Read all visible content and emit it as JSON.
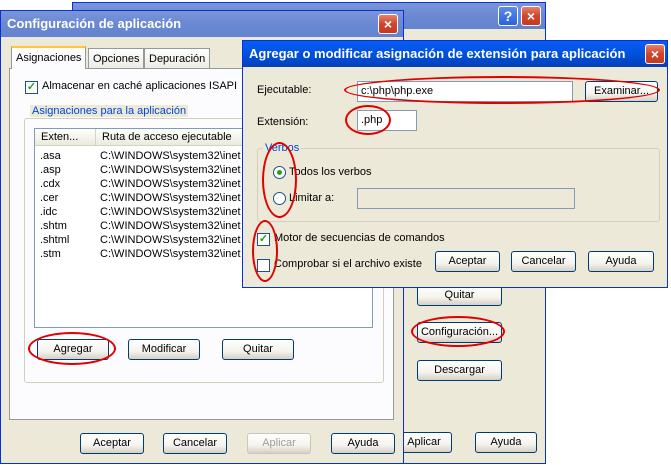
{
  "back_window": {
    "help_icon": "?",
    "close_icon": "×",
    "buttons": {
      "quitar": "Quitar",
      "configuracion": "Configuración...",
      "descargar": "Descargar",
      "aplicar": "Aplicar",
      "ayuda": "Ayuda"
    }
  },
  "config_window": {
    "title": "Configuración de aplicación",
    "close_icon": "×",
    "tabs": [
      "Asignaciones",
      "Opciones",
      "Depuración"
    ],
    "cache_checkbox": {
      "label": "Almacenar en caché aplicaciones ISAPI",
      "checked": true
    },
    "group_label": "Asignaciones para la aplicación",
    "columns": [
      "Exten...",
      "Ruta de acceso ejecutable"
    ],
    "rows": [
      {
        "ext": ".asa",
        "path": "C:\\WINDOWS\\system32\\inet"
      },
      {
        "ext": ".asp",
        "path": "C:\\WINDOWS\\system32\\inet"
      },
      {
        "ext": ".cdx",
        "path": "C:\\WINDOWS\\system32\\inet"
      },
      {
        "ext": ".cer",
        "path": "C:\\WINDOWS\\system32\\inet"
      },
      {
        "ext": ".idc",
        "path": "C:\\WINDOWS\\system32\\inet"
      },
      {
        "ext": ".shtm",
        "path": "C:\\WINDOWS\\system32\\inet"
      },
      {
        "ext": ".shtml",
        "path": "C:\\WINDOWS\\system32\\inet"
      },
      {
        "ext": ".stm",
        "path": "C:\\WINDOWS\\system32\\inet"
      }
    ],
    "buttons": {
      "agregar": "Agregar",
      "modificar": "Modificar",
      "quitar": "Quitar"
    },
    "footer": {
      "aceptar": "Aceptar",
      "cancelar": "Cancelar",
      "aplicar": "Aplicar",
      "ayuda": "Ayuda"
    }
  },
  "ext_dialog": {
    "title": "Agregar o modificar asignación de extensión para aplicación",
    "close_icon": "×",
    "executable_label": "Ejecutable:",
    "executable_value": "c:\\php\\php.exe",
    "browse_button": "Examinar...",
    "extension_label": "Extensión:",
    "extension_value": ".php",
    "verbs_group": "Verbos",
    "all_verbs": {
      "label": "Todos los verbos",
      "selected": true
    },
    "limit_to": {
      "label": "Limitar a:",
      "selected": false,
      "value": ""
    },
    "script_engine": {
      "label": "Motor de secuencias de comandos",
      "checked": true
    },
    "check_file": {
      "label": "Comprobar si el archivo existe",
      "checked": false
    },
    "buttons": {
      "aceptar": "Aceptar",
      "cancelar": "Cancelar",
      "ayuda": "Ayuda"
    }
  },
  "colors": {
    "title_active": "#0054e3",
    "annotation": "#e00000",
    "dialog_bg": "#ece9d8",
    "group_label": "#0046d5"
  }
}
